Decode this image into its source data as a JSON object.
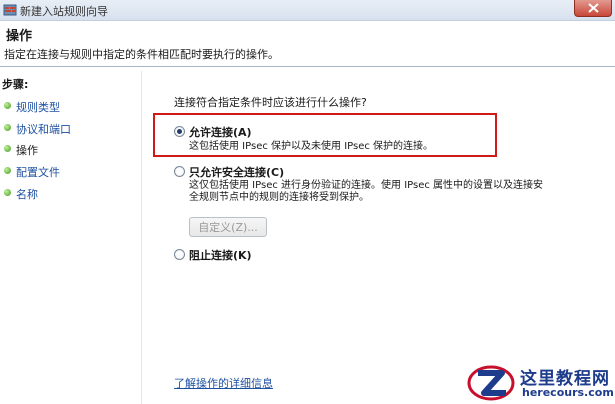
{
  "window": {
    "title": "新建入站规则向导"
  },
  "header": {
    "title": "操作",
    "description": "指定在连接与规则中指定的条件相匹配时要执行的操作。"
  },
  "steps": {
    "heading": "步骤:",
    "items": [
      {
        "label": "规则类型",
        "active": false
      },
      {
        "label": "协议和端口",
        "active": false
      },
      {
        "label": "操作",
        "active": true
      },
      {
        "label": "配置文件",
        "active": false
      },
      {
        "label": "名称",
        "active": false
      }
    ]
  },
  "main": {
    "question": "连接符合指定条件时应该进行什么操作?",
    "options": [
      {
        "label": "允许连接(A)",
        "checked": true,
        "description": [
          "这包括使用 IPsec 保护以及未使用 IPsec 保护的连接。"
        ]
      },
      {
        "label": "只允许安全连接(C)",
        "checked": false,
        "description": [
          "这仅包括使用 IPsec 进行身份验证的连接。使用 IPsec 属性中的设置以及连接安",
          "全规则节点中的规则的连接将受到保护。"
        ]
      },
      {
        "label": "阻止连接(K)",
        "checked": false,
        "description": []
      }
    ],
    "customize_button": "自定义(Z)...",
    "learn_more_link": "了解操作的详细信息"
  },
  "watermark": {
    "title": "这里教程网",
    "subtitle": "herecours.com",
    "brand_color": "#1e3c8c"
  },
  "colors": {
    "highlight_border": "#d01a1a",
    "link": "#1e50a2",
    "step_dot": "#3f9a1f"
  }
}
